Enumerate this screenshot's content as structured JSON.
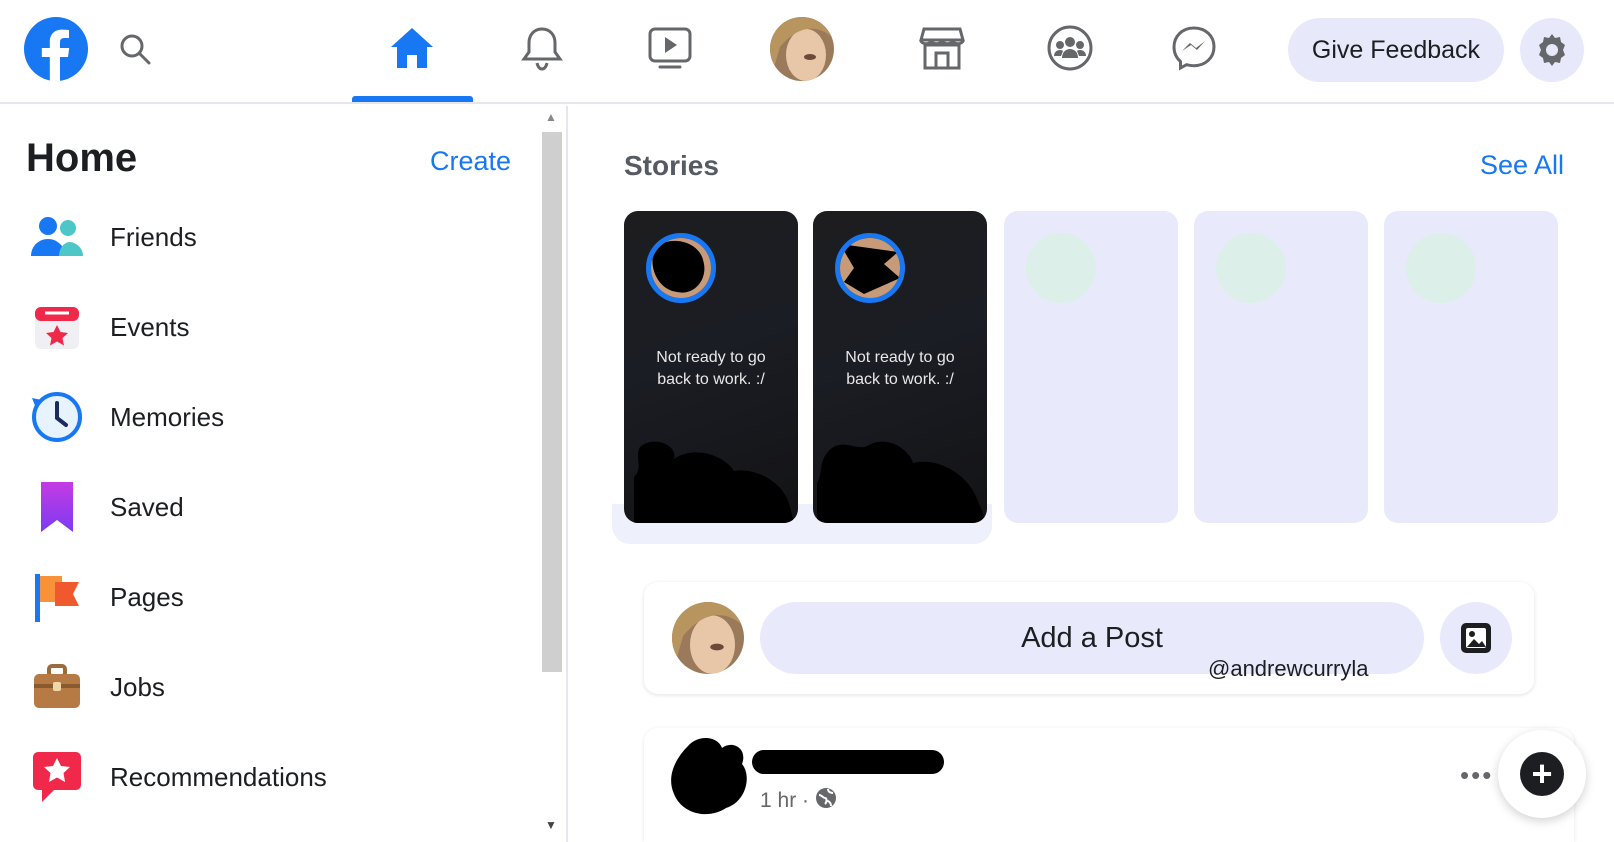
{
  "topbar": {
    "feedback_label": "Give Feedback",
    "nav_items": [
      "home-icon",
      "bell-icon",
      "video-icon",
      "profile-avatar",
      "marketplace-icon",
      "groups-icon",
      "messenger-icon"
    ],
    "accent_color": "#1877f2"
  },
  "sidebar": {
    "title": "Home",
    "create_label": "Create",
    "items": [
      {
        "label": "Friends",
        "icon": "friends-icon"
      },
      {
        "label": "Events",
        "icon": "events-icon"
      },
      {
        "label": "Memories",
        "icon": "memories-icon"
      },
      {
        "label": "Saved",
        "icon": "saved-icon"
      },
      {
        "label": "Pages",
        "icon": "pages-icon"
      },
      {
        "label": "Jobs",
        "icon": "jobs-icon"
      },
      {
        "label": "Recommendations",
        "icon": "recommendations-icon"
      }
    ]
  },
  "stories": {
    "title": "Stories",
    "see_all_label": "See All",
    "cards": [
      {
        "text": "Not ready to go back to work. :/"
      },
      {
        "text": "Not ready to go back to work. :/"
      }
    ]
  },
  "composer": {
    "add_post_label": "Add a Post"
  },
  "watermark": "@andrewcurryla",
  "post": {
    "time": "1 hr ·",
    "more_label": "•••"
  },
  "fab_label": "+"
}
